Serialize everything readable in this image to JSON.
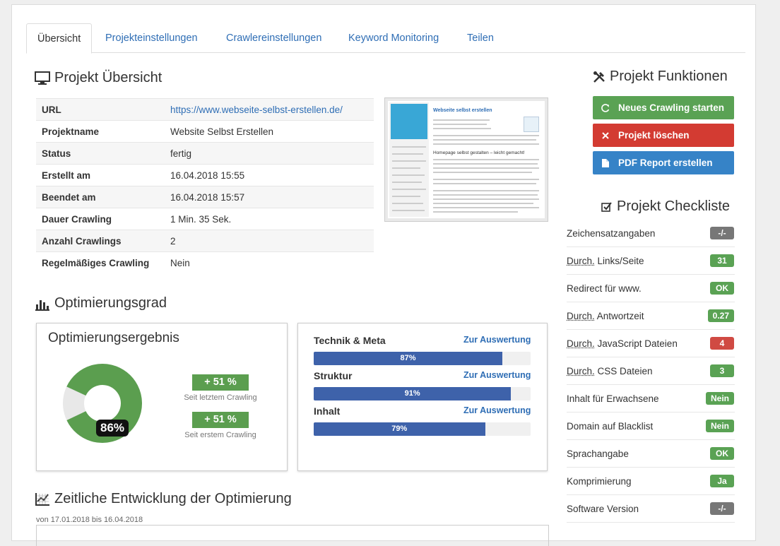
{
  "tabs": [
    {
      "label": "Übersicht"
    },
    {
      "label": "Projekteinstellungen"
    },
    {
      "label": "Crawlereinstellungen"
    },
    {
      "label": "Keyword Monitoring"
    },
    {
      "label": "Teilen"
    }
  ],
  "overview": {
    "title": "Projekt Übersicht",
    "rows": [
      {
        "key": "URL",
        "value": "https://www.webseite-selbst-erstellen.de/"
      },
      {
        "key": "Projektname",
        "value": "Website Selbst Erstellen"
      },
      {
        "key": "Status",
        "value": "fertig"
      },
      {
        "key": "Erstellt am",
        "value": "16.04.2018 15:55"
      },
      {
        "key": "Beendet am",
        "value": "16.04.2018 15:57"
      },
      {
        "key": "Dauer Crawling",
        "value": "1 Min. 35 Sek."
      },
      {
        "key": "Anzahl Crawlings",
        "value": "2"
      },
      {
        "key": "Regelmäßiges Crawling",
        "value": "Nein"
      }
    ],
    "thumbnail": {
      "site_title": "Webseite selbst erstellen",
      "subtitle": "Homepage selbst gestalten – leicht gemacht!"
    }
  },
  "optimization": {
    "title": "Optimierungsgrad",
    "result_title": "Optimierungsergebnis",
    "score_label": "86%",
    "score_fraction": 0.86,
    "deltas": [
      {
        "value": "+ 51 %",
        "caption": "Seit letztem Crawling"
      },
      {
        "value": "+ 51 %",
        "caption": "Seit erstem Crawling"
      }
    ],
    "categories": [
      {
        "name": "Technik & Meta",
        "link": "Zur Auswertung",
        "percent_label": "87%",
        "percent": 87
      },
      {
        "name": "Struktur",
        "link": "Zur Auswertung",
        "percent_label": "91%",
        "percent": 91
      },
      {
        "name": "Inhalt",
        "link": "Zur Auswertung",
        "percent_label": "79%",
        "percent": 79
      }
    ]
  },
  "timeline": {
    "title": "Zeitliche Entwicklung der Optimierung",
    "range": "von 17.01.2018 bis 16.04.2018"
  },
  "functions": {
    "title": "Projekt Funktionen",
    "buttons": [
      {
        "label": "Neues Crawling starten",
        "color": "#5aa254"
      },
      {
        "label": "Projekt löschen",
        "color": "#d33b32"
      },
      {
        "label": "PDF Report erstellen",
        "color": "#3683c7"
      }
    ]
  },
  "checklist": {
    "title": "Projekt Checkliste",
    "items": [
      {
        "abbr": "",
        "label": "Zeichensatzangaben",
        "badge": "-/-",
        "status": "gray"
      },
      {
        "abbr": "Durch.",
        "label": " Links/Seite",
        "badge": "31",
        "status": "green"
      },
      {
        "abbr": "",
        "label": "Redirect für www.",
        "badge": "OK",
        "status": "green"
      },
      {
        "abbr": "Durch.",
        "label": " Antwortzeit",
        "badge": "0.27",
        "status": "green"
      },
      {
        "abbr": "Durch.",
        "label": " JavaScript Dateien",
        "badge": "4",
        "status": "red"
      },
      {
        "abbr": "Durch.",
        "label": " CSS Dateien",
        "badge": "3",
        "status": "green"
      },
      {
        "abbr": "",
        "label": "Inhalt für Erwachsene",
        "badge": "Nein",
        "status": "green"
      },
      {
        "abbr": "",
        "label": "Domain auf Blacklist",
        "badge": "Nein",
        "status": "green"
      },
      {
        "abbr": "",
        "label": "Sprachangabe",
        "badge": "OK",
        "status": "green"
      },
      {
        "abbr": "",
        "label": "Komprimierung",
        "badge": "Ja",
        "status": "green"
      },
      {
        "abbr": "",
        "label": "Software Version",
        "badge": "-/-",
        "status": "gray"
      }
    ]
  },
  "colors": {
    "accent": "#2f6eb5",
    "donut_filled": "#5b9e4f",
    "donut_empty": "#e8e8e8",
    "bar_fill": "#3e62aa"
  }
}
